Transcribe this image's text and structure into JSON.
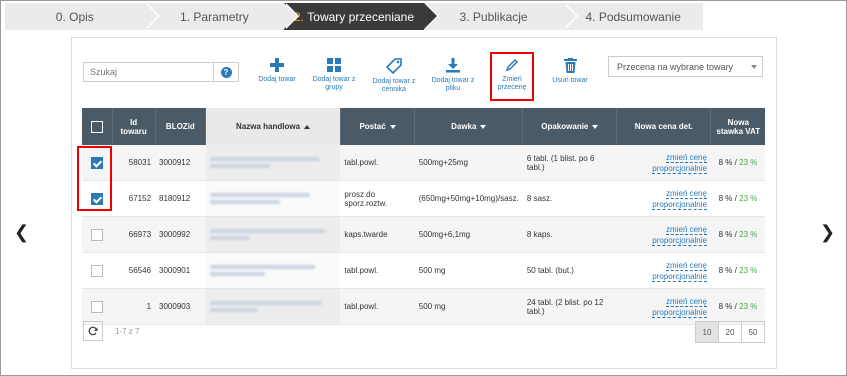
{
  "steps": [
    {
      "num": "0.",
      "label": "Opis"
    },
    {
      "num": "1.",
      "label": "Parametry"
    },
    {
      "num": "2.",
      "label": "Towary przeceniane"
    },
    {
      "num": "3.",
      "label": "Publikacje"
    },
    {
      "num": "4.",
      "label": "Podsumowanie"
    }
  ],
  "search": {
    "placeholder": "Szukaj"
  },
  "toolbar": {
    "add": "Dodaj towar",
    "add_group": "Dodaj towar z grupy",
    "add_pricelist": "Dodaj towar z cennika",
    "add_file": "Dodaj towar z pliku",
    "change_discount": "Zmień przecenę",
    "remove": "Usuń towar"
  },
  "select": {
    "value": "Przecena na wybrane towary"
  },
  "table": {
    "headers": {
      "id": "Id towaru",
      "blozid": "BLOZid",
      "name": "Nazwa handlowa",
      "form": "Postać",
      "dose": "Dawka",
      "pack": "Opakowanie",
      "new_price": "Nowa cena det.",
      "new_vat": "Nowa stawka VAT"
    },
    "rows": [
      {
        "checked": true,
        "id": "58031",
        "bloz": "3000912",
        "form": "tabl.powl.",
        "dose": "500mg+25mg",
        "pack": "6 tabl. (1 blist. po 6 tabl.)",
        "link": "zmień cenę proporcjonalnie",
        "vat_a": "8 %",
        "vat_b": "23 %"
      },
      {
        "checked": true,
        "id": "67152",
        "bloz": "8180912",
        "form": "prosz.do sporz.roztw.",
        "dose": "(650mg+50mg+10mg)/sasz.",
        "pack": "8 sasz.",
        "link": "zmień cenę proporcjonalnie",
        "vat_a": "8 %",
        "vat_b": "23 %"
      },
      {
        "checked": false,
        "id": "66973",
        "bloz": "3000992",
        "form": "kaps.twarde",
        "dose": "500mg+6,1mg",
        "pack": "8 kaps.",
        "link": "zmień cenę proporcjonalnie",
        "vat_a": "8 %",
        "vat_b": "23 %"
      },
      {
        "checked": false,
        "id": "56546",
        "bloz": "3000901",
        "form": "tabl.powl.",
        "dose": "500 mg",
        "pack": "50 tabl. (but.)",
        "link": "zmień cenę proporcjonalnie",
        "vat_a": "8 %",
        "vat_b": "23 %"
      },
      {
        "checked": false,
        "id": "1",
        "bloz": "3000903",
        "form": "tabl.powl.",
        "dose": "500 mg",
        "pack": "24 tabl. (2 blist. po 12 tabl.)",
        "link": "zmień cenę proporcjonalnie",
        "vat_a": "8 %",
        "vat_b": "23 %"
      }
    ]
  },
  "footer": {
    "count": "1-7 z 7",
    "page_sizes": [
      "10",
      "20",
      "50"
    ],
    "selected_size": "10"
  },
  "colors": {
    "accent": "#2a7ab8",
    "header_bg": "#4a5a66",
    "highlight": "#e00000"
  }
}
